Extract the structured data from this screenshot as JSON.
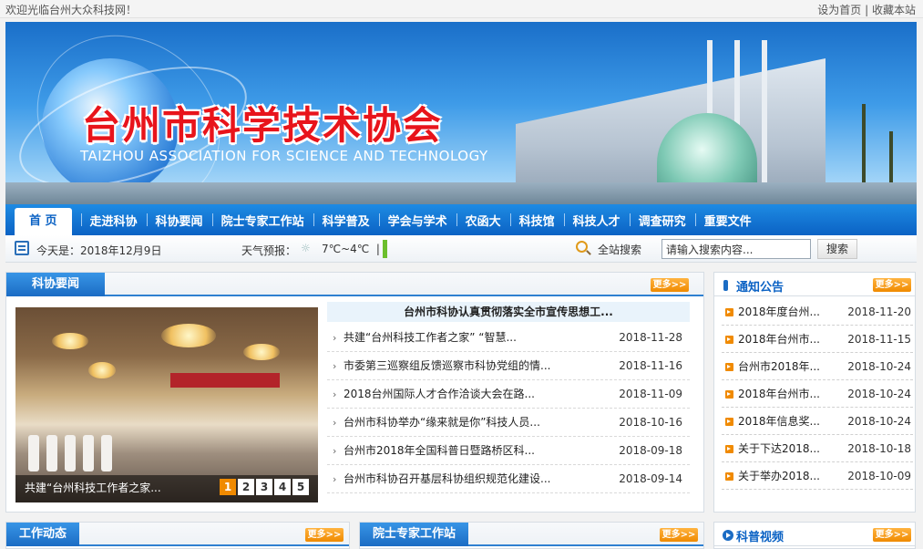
{
  "topbar": {
    "welcome": "欢迎光临台州大众科技网！",
    "set_home": "设为首页",
    "separator": "|",
    "bookmark": "收藏本站"
  },
  "banner": {
    "title": "台州市科学技术协会",
    "subtitle": "TAIZHOU ASSOCIATION FOR SCIENCE AND TECHNOLOGY"
  },
  "nav": {
    "items": [
      "首 页",
      "走进科协",
      "科协要闻",
      "院士专家工作站",
      "科学普及",
      "学会与学术",
      "农函大",
      "科技馆",
      "科技人才",
      "调查研究",
      "重要文件"
    ]
  },
  "infobar": {
    "today": "今天是：2018年12月9日",
    "weather_label": "天气预报：",
    "weather_icon": "☼",
    "temperature": "7℃~4℃",
    "temp_sep": "|",
    "search_label": "全站搜索",
    "search_placeholder": "请输入搜索内容...",
    "search_button": "搜索"
  },
  "news": {
    "tab": "科协要闻",
    "more": "更多>>",
    "headline": "台州市科协认真贯彻落实全市宣传思想工...",
    "caption": "共建“台州科技工作者之家...",
    "pages": [
      "1",
      "2",
      "3",
      "4",
      "5"
    ],
    "items": [
      {
        "title": "共建“台州科技工作者之家”  “智慧...",
        "date": "2018-11-28"
      },
      {
        "title": "市委第三巡察组反馈巡察市科协党组的情...",
        "date": "2018-11-16"
      },
      {
        "title": "2018台州国际人才合作洽谈大会在路...",
        "date": "2018-11-09"
      },
      {
        "title": "台州市科协举办“缘来就是你”科技人员...",
        "date": "2018-10-16"
      },
      {
        "title": "台州市2018年全国科普日暨路桥区科...",
        "date": "2018-09-18"
      },
      {
        "title": "台州市科协召开基层科协组织规范化建设...",
        "date": "2018-09-14"
      }
    ]
  },
  "notice": {
    "title": "通知公告",
    "more": "更多>>",
    "items": [
      {
        "title": "2018年度台州...",
        "date": "2018-11-20"
      },
      {
        "title": "2018年台州市...",
        "date": "2018-11-15"
      },
      {
        "title": "台州市2018年...",
        "date": "2018-10-24"
      },
      {
        "title": "2018年台州市...",
        "date": "2018-10-24"
      },
      {
        "title": "2018年信息奖...",
        "date": "2018-10-24"
      },
      {
        "title": "关于下达2018...",
        "date": "2018-10-18"
      },
      {
        "title": "关于举办2018...",
        "date": "2018-10-09"
      }
    ]
  },
  "bottom": {
    "work_news": "工作动态",
    "expert_station": "院士专家工作站",
    "science_video": "科普视频",
    "more": "更多>>"
  },
  "colors": {
    "nav_blue": "#0b62c4",
    "accent_orange": "#f08a00",
    "title_red": "#e8141b"
  }
}
